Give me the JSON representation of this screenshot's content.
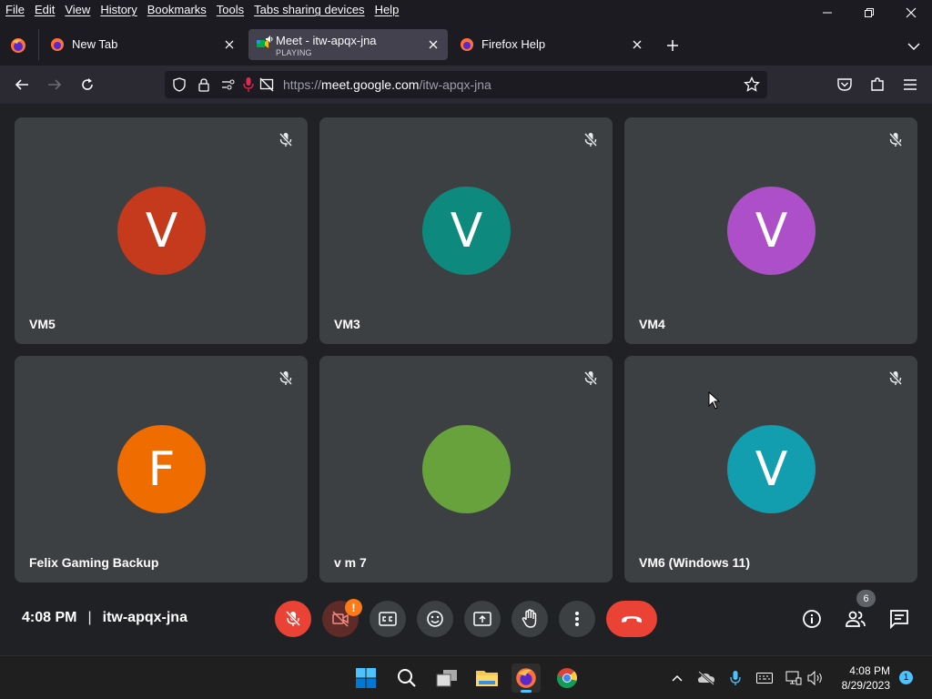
{
  "menubar": {
    "items": [
      "File",
      "Edit",
      "View",
      "History",
      "Bookmarks",
      "Tools",
      "Tabs sharing devices",
      "Help"
    ]
  },
  "tabs": [
    {
      "title": "New Tab",
      "active": false
    },
    {
      "title": "Meet - itw-apqx-jna",
      "subtitle": "PLAYING",
      "active": true
    },
    {
      "title": "Firefox Help",
      "active": false
    }
  ],
  "urlbar": {
    "url_prefix": "https://",
    "url_host": "meet.google.com",
    "url_path": "/itw-apqx-jna"
  },
  "participants": [
    {
      "name": "VM5",
      "initial": "V",
      "color": "#c5391c"
    },
    {
      "name": "VM3",
      "initial": "V",
      "color": "#0d8a7d"
    },
    {
      "name": "VM4",
      "initial": "V",
      "color": "#ad4fc8"
    },
    {
      "name": "Felix Gaming Backup",
      "initial": "F",
      "color": "#ef6c00"
    },
    {
      "name": "v m 7",
      "initial": "",
      "color": "#67a23c"
    },
    {
      "name": "VM6 (Windows 11)",
      "initial": "V",
      "color": "#129eaf"
    }
  ],
  "meeting": {
    "time": "4:08 PM",
    "separator": "|",
    "code": "itw-apqx-jna",
    "participant_count": "6",
    "camera_warning": "!"
  },
  "taskbar": {
    "time": "4:08 PM",
    "date": "8/29/2023",
    "notifications": "1"
  }
}
